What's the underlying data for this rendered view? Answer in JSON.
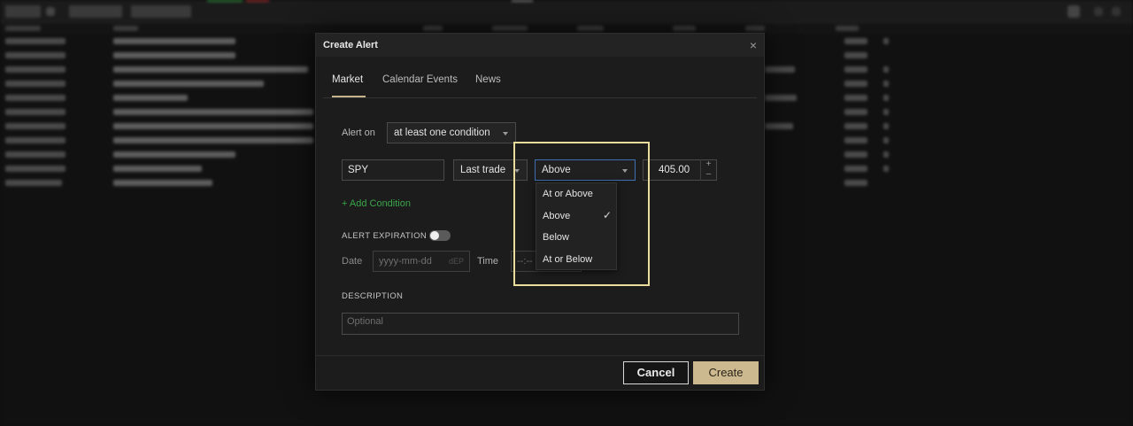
{
  "modal": {
    "title": "Create Alert",
    "close_icon": "close-icon",
    "tabs": [
      {
        "label": "Market",
        "active": true
      },
      {
        "label": "Calendar Events",
        "active": false
      },
      {
        "label": "News",
        "active": false
      }
    ],
    "alert_on": {
      "label": "Alert on",
      "value": "at least one condition"
    },
    "condition": {
      "symbol": "SPY",
      "field": "Last trade",
      "operator": "Above",
      "value": "405.00",
      "increment_icon": "+",
      "decrement_icon": "–"
    },
    "operator_options": [
      {
        "label": "At or Above",
        "selected": false
      },
      {
        "label": "Above",
        "selected": true
      },
      {
        "label": "Below",
        "selected": false
      },
      {
        "label": "At or Below",
        "selected": false
      }
    ],
    "add_condition_label": "+ Add Condition",
    "expiration": {
      "label": "ALERT EXPIRATION",
      "enabled": false,
      "date_label": "Date",
      "date_placeholder": "yyyy-mm-dd",
      "date_suffix": "dEP",
      "time_label": "Time",
      "time_placeholder": "--:--"
    },
    "description": {
      "label": "DESCRIPTION",
      "placeholder": "Optional"
    },
    "buttons": {
      "cancel": "Cancel",
      "create": "Create"
    }
  },
  "colors": {
    "highlight": "#eadc9a",
    "create_button": "#cdb98f",
    "add_condition": "#3aa54a",
    "focused_border": "#3f6fb3"
  }
}
